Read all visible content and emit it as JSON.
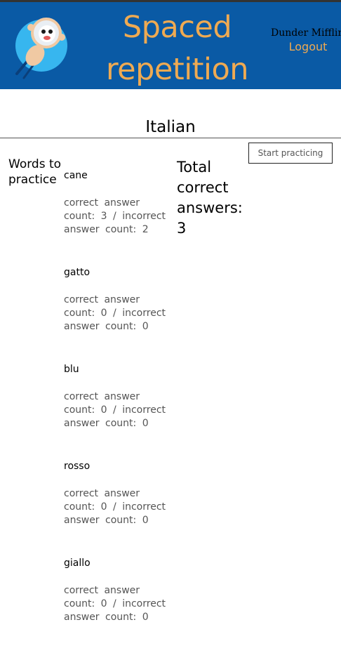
{
  "header": {
    "title": "Spaced repetition",
    "user_name": "Dunder Mifflin Admin",
    "logout_label": "Logout",
    "logo_icon": "astronaut-rocket-icon",
    "colors": {
      "header_bg": "#0a5aa5",
      "accent": "#efaa52"
    }
  },
  "dashboard": {
    "language": "Italian",
    "start_button_label": "Start practicing",
    "words_heading": "Words to practice",
    "total_label": "Total correct answers:",
    "total_value": "3"
  },
  "words": [
    {
      "word": "cane",
      "correct_label": "correct answer count:",
      "correct": "3",
      "separator": "/",
      "incorrect_label": "incorrect answer count:",
      "incorrect": "2"
    },
    {
      "word": "gatto",
      "correct_label": "correct answer count:",
      "correct": "0",
      "separator": "/",
      "incorrect_label": "incorrect answer count:",
      "incorrect": "0"
    },
    {
      "word": "blu",
      "correct_label": "correct answer count:",
      "correct": "0",
      "separator": "/",
      "incorrect_label": "incorrect answer count:",
      "incorrect": "0"
    },
    {
      "word": "rosso",
      "correct_label": "correct answer count:",
      "correct": "0",
      "separator": "/",
      "incorrect_label": "incorrect answer count:",
      "incorrect": "0"
    },
    {
      "word": "giallo",
      "correct_label": "correct answer count:",
      "correct": "0",
      "separator": "/",
      "incorrect_label": "incorrect answer count:",
      "incorrect": "0"
    }
  ]
}
